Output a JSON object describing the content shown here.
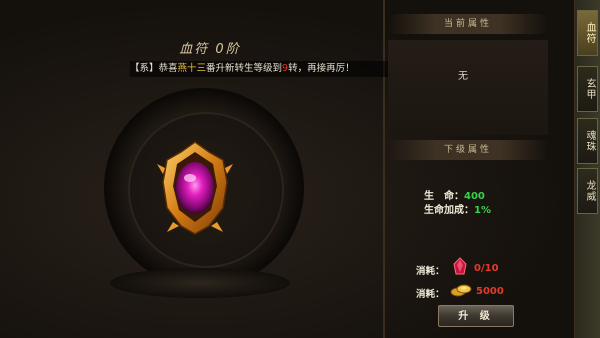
{
  "left": {
    "title": "血符 0阶",
    "system_message": {
      "prefix": "【系】恭喜",
      "player": "燕十三",
      "middle": "番升新转生等级到",
      "level": "9",
      "suffix": "转，再接再厉！"
    }
  },
  "right": {
    "current_attr_header": "当前属性",
    "current_attr_value": "无",
    "next_attr_header": "下级属性",
    "next_attrs": [
      {
        "label": "生　命：",
        "value": "400"
      },
      {
        "label": "生命加成：",
        "value": "1%"
      }
    ],
    "costs": [
      {
        "label": "消耗：",
        "icon": "red-crystal-icon",
        "value": "0/10"
      },
      {
        "label": "消耗：",
        "icon": "gold-coin-icon",
        "value": "5000"
      }
    ],
    "upgrade_button": "升 级"
  },
  "side_tabs": [
    {
      "label": "血符",
      "active": true
    },
    {
      "label": "玄甲",
      "active": false
    },
    {
      "label": "魂珠",
      "active": false
    },
    {
      "label": "龙威",
      "active": false
    }
  ],
  "colors": {
    "accent_gold": "#e9c13a",
    "highlight_red": "#e23b2a",
    "attr_green": "#37d34a"
  }
}
